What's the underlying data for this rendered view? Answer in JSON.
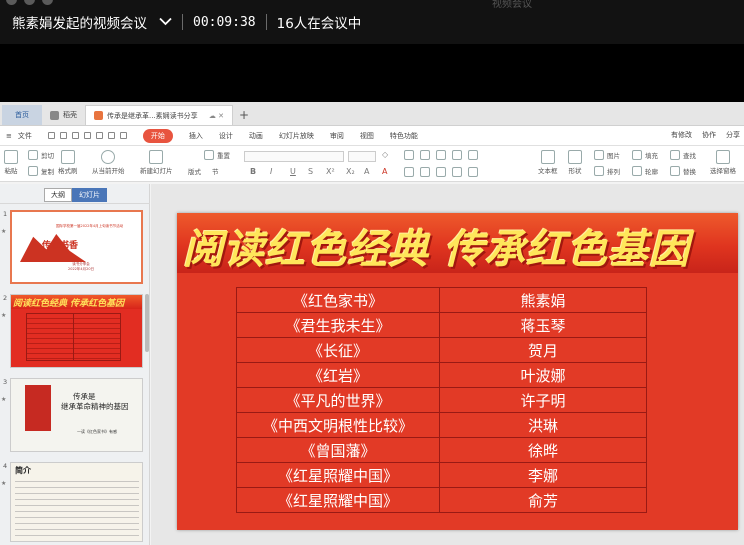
{
  "meeting": {
    "title": "熊素娟发起的视频会议",
    "timer": "00:09:38",
    "participants": "16人在会议中",
    "top_ghost_text": "视频会议"
  },
  "tabs": [
    {
      "label": "首页"
    },
    {
      "label": "稻壳"
    },
    {
      "label": "传承是继承革...素娴读书分享"
    }
  ],
  "menu": {
    "items": [
      "文件",
      "开始",
      "插入",
      "设计",
      "动画",
      "幻灯片放映",
      "审阅",
      "视图",
      "特色功能"
    ],
    "right": [
      "有修改",
      "协作",
      "分享"
    ]
  },
  "ribbon": {
    "paste": "粘贴",
    "cut": "剪切",
    "copy": "复制",
    "format_painter": "格式刷",
    "from_current": "从当前开始",
    "new_slide": "新建幻灯片",
    "layout": "版式",
    "section": "节",
    "reset": "重置",
    "textbox": "文本框",
    "shape": "形状",
    "arrange": "排列",
    "picture": "图片",
    "fill": "填充",
    "outline": "轮廓",
    "find": "查找",
    "replace": "替换",
    "select_pane": "选择窗格"
  },
  "left_panel": {
    "tab_outline": "大纲",
    "tab_slides": "幻灯片",
    "slide_numbers": [
      "1",
      "2",
      "3",
      "4"
    ],
    "thumb1": {
      "big": "传承书香",
      "title": "国际学校第一届2022年4月上旬读书节活动",
      "sub1": "读书分享会",
      "sub2": "2022年4月20日"
    },
    "thumb2": {
      "title": "阅读红色经典 传承红色基因"
    },
    "thumb3": {
      "line1": "传承是",
      "line2": "继承革命精神的基因",
      "line3": "—读《红色家书》有感"
    },
    "thumb4": {
      "heading": "简介"
    }
  },
  "slide": {
    "title": "阅读红色经典 传承红色基因",
    "rows": [
      {
        "book": "《红色家书》",
        "reader": "熊素娟"
      },
      {
        "book": "《君生我未生》",
        "reader": "蒋玉琴"
      },
      {
        "book": "《长征》",
        "reader": "贺月"
      },
      {
        "book": "《红岩》",
        "reader": "叶波娜"
      },
      {
        "book": "《平凡的世界》",
        "reader": "许子明"
      },
      {
        "book": "《中西文明根性比较》",
        "reader": "洪琳"
      },
      {
        "book": "《曾国藩》",
        "reader": "徐晔"
      },
      {
        "book": "《红星照耀中国》",
        "reader": "李娜"
      },
      {
        "book": "《红星照耀中国》",
        "reader": "俞芳"
      }
    ]
  },
  "colors": {
    "accent": "#e8543f",
    "slide_red": "#e23a26",
    "title_yellow": "#ffe65a"
  }
}
